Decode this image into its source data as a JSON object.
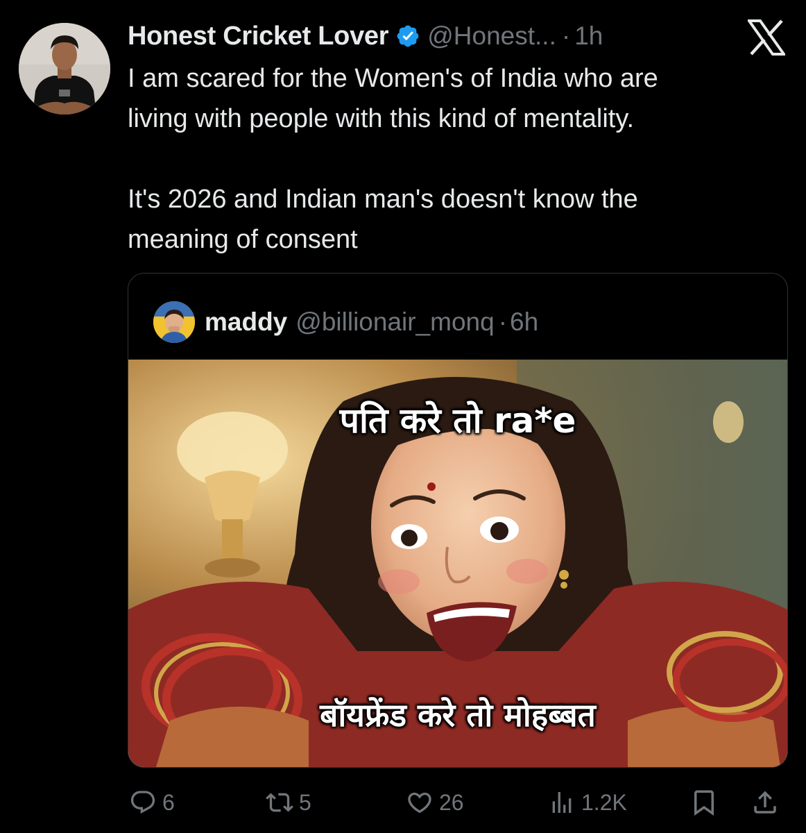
{
  "tweet": {
    "author_name": "Honest Cricket Lover",
    "handle": "@Honest...",
    "separator": "·",
    "time": "1h",
    "text_line1": "I am scared for the Women's of India who are",
    "text_line2": "living with people with this kind of mentality.",
    "text_line3": "It's 2026 and Indian man's doesn't  know the",
    "text_line4": "meaning of consent"
  },
  "quoted": {
    "author_name": "maddy",
    "handle": "@billionair_monq",
    "separator": "·",
    "time": "6h",
    "meme_caption_top": "पति करे तो ra*e",
    "meme_caption_bottom": "बॉयफ्रेंड करे तो मोहब्बत"
  },
  "actions": {
    "replies": "6",
    "reposts": "5",
    "likes": "26",
    "views": "1.2K"
  },
  "icons": {
    "verified": "verified-badge-icon",
    "brand": "x-logo-icon",
    "reply": "reply-icon",
    "repost": "repost-icon",
    "like": "heart-icon",
    "views": "views-icon",
    "bookmark": "bookmark-icon",
    "share": "share-icon"
  },
  "colors": {
    "background": "#000000",
    "text": "#e7e9ea",
    "muted": "#71767b",
    "verified": "#1d9bf0",
    "border": "#2f3336"
  }
}
